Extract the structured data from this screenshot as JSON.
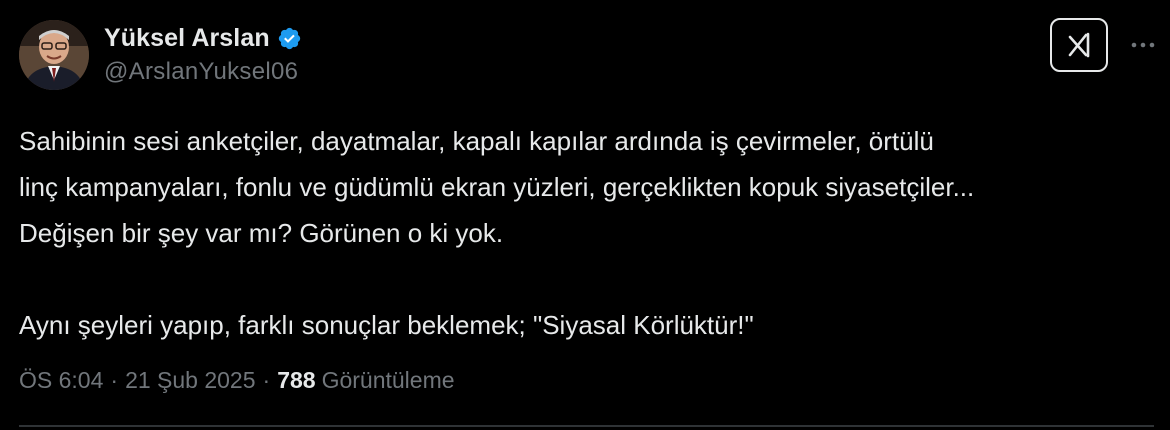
{
  "author": {
    "display_name": "Yüksel Arslan",
    "handle": "@ArslanYuksel06",
    "verified": true,
    "verified_color": "#1d9bf0",
    "avatar_icon": "profile-photo"
  },
  "tweet": {
    "lines": [
      "Sahibinin sesi anketçiler, dayatmalar, kapalı kapılar ardında iş çevirmeler, örtülü",
      "linç kampanyaları, fonlu ve güdümlü ekran yüzleri, gerçeklikten kopuk siyasetçiler...",
      "Değişen bir şey var mı? Görünen o ki yok.",
      "",
      "Aynı şeyleri yapıp, farklı sonuçlar beklemek; \"Siyasal Körlüktür!\""
    ]
  },
  "meta": {
    "time": "ÖS 6:04",
    "separator": "·",
    "date": "21 Şub 2025",
    "views_count": "788",
    "views_label": "Görüntüleme"
  },
  "actions": {
    "grok_icon": "grok-icon",
    "more_icon": "more-icon"
  },
  "colors": {
    "background": "#000000",
    "text": "#e7e9ea",
    "secondary_text": "#71767b",
    "divider": "#2f3336"
  }
}
